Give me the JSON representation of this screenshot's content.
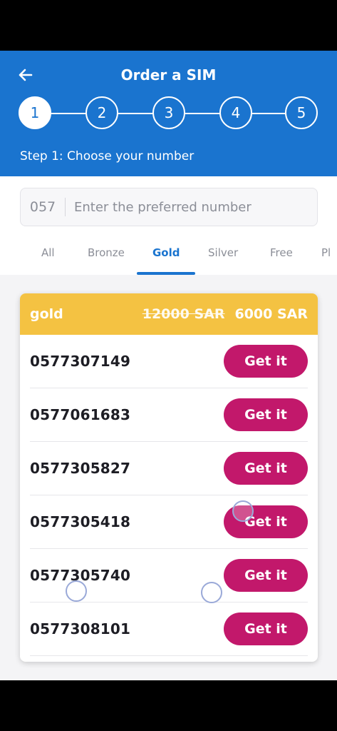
{
  "header": {
    "title": "Order a SIM",
    "back_icon": "arrow-left-icon",
    "step_caption": "Step 1: Choose your number"
  },
  "stepper": {
    "steps": [
      "1",
      "2",
      "3",
      "4",
      "5"
    ],
    "active_index": 0
  },
  "search": {
    "prefix": "057",
    "placeholder": "Enter the preferred number",
    "value": ""
  },
  "tabs": {
    "items": [
      "All",
      "Bronze",
      "Gold",
      "Silver",
      "Free",
      "Pl"
    ],
    "active": "Gold"
  },
  "card": {
    "tier": "gold",
    "old_price": "12000 SAR",
    "new_price": "6000 SAR",
    "numbers": [
      "0577307149",
      "0577061683",
      "0577305827",
      "0577305418",
      "0577305740",
      "0577308101"
    ],
    "button_label": "Get it"
  },
  "colors": {
    "header_blue": "#1a74cf",
    "gold": "#f4c242",
    "button_magenta": "#c2186b"
  }
}
